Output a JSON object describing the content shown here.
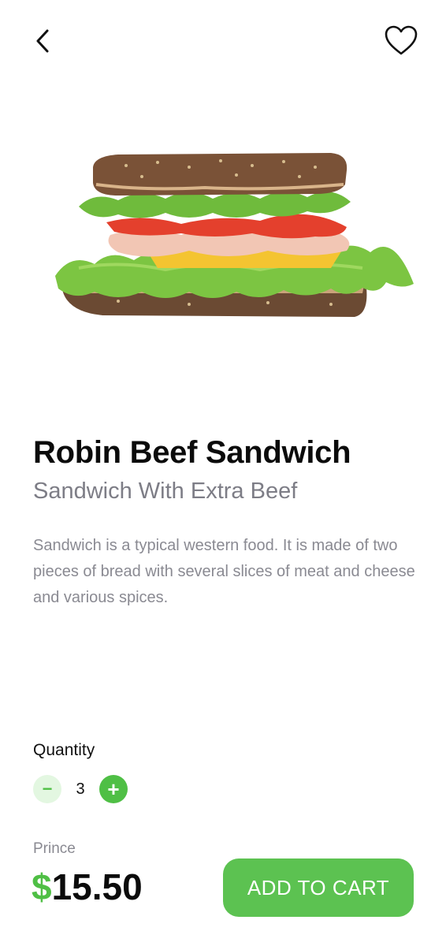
{
  "header": {
    "back_icon": "chevron-left-icon",
    "favorite_icon": "heart-outline-icon"
  },
  "product": {
    "image": "sandwich-photo",
    "name": "Robin Beef Sandwich",
    "subtitle": "Sandwich With Extra Beef",
    "description": "Sandwich is a typical western food. It is made of two pieces of bread with several slices of meat and cheese and various spices."
  },
  "quantity": {
    "label": "Quantity",
    "minus_label": "−",
    "plus_label": "+",
    "value": "3"
  },
  "price": {
    "label": "Prince",
    "currency": "$",
    "amount": "15.50"
  },
  "cart_button": {
    "label": "ADD TO CART"
  },
  "colors": {
    "accent": "#5cc251",
    "accent_light": "#e3f7e1",
    "text_primary": "#0b0b0b",
    "text_secondary": "#7d7d86"
  }
}
